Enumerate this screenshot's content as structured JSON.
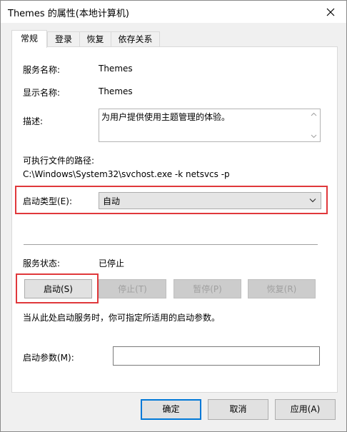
{
  "window": {
    "title": "Themes 的属性(本地计算机)"
  },
  "tabs": [
    {
      "label": "常规",
      "active": true
    },
    {
      "label": "登录"
    },
    {
      "label": "恢复"
    },
    {
      "label": "依存关系"
    }
  ],
  "general": {
    "service_name_label": "服务名称:",
    "service_name_value": "Themes",
    "display_name_label": "显示名称:",
    "display_name_value": "Themes",
    "description_label": "描述:",
    "description_value": "为用户提供使用主题管理的体验。",
    "exe_path_label": "可执行文件的路径:",
    "exe_path_value": "C:\\Windows\\System32\\svchost.exe -k netsvcs -p",
    "startup_type_label": "启动类型(E):",
    "startup_type_value": "自动",
    "service_status_label": "服务状态:",
    "service_status_value": "已停止",
    "start_button": "启动(S)",
    "stop_button": "停止(T)",
    "pause_button": "暂停(P)",
    "resume_button": "恢复(R)",
    "hint_text": "当从此处启动服务时，你可指定所适用的启动参数。",
    "start_params_label": "启动参数(M):",
    "start_params_value": ""
  },
  "footer": {
    "ok_button": "确定",
    "cancel_button": "取消",
    "apply_button": "应用(A)"
  },
  "colors": {
    "highlight": "#e0383b",
    "accent": "#0078d7"
  }
}
